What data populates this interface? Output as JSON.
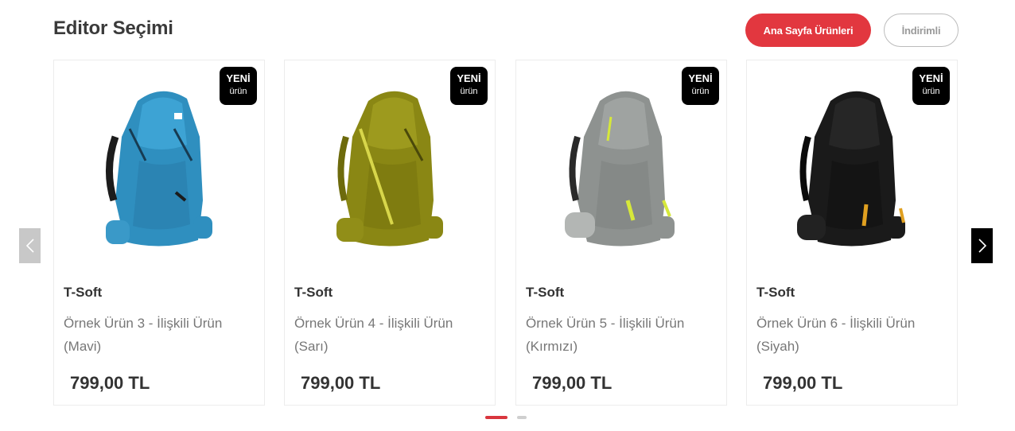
{
  "section": {
    "title": "Editor Seçimi"
  },
  "tabs": [
    {
      "label": "Ana Sayfa Ürünleri",
      "active": true
    },
    {
      "label": "İndirimli",
      "active": false
    }
  ],
  "colors": {
    "accent": "#e2373f",
    "badge": "#000000"
  },
  "products": [
    {
      "badge_line1": "YENİ",
      "badge_line2": "ürün",
      "brand": "T-Soft",
      "name": "Örnek Ürün 3 - İlişkili Ürün (Mavi)",
      "price": "799,00 TL",
      "image_icon": "backpack-blue-image"
    },
    {
      "badge_line1": "YENİ",
      "badge_line2": "ürün",
      "brand": "T-Soft",
      "name": "Örnek Ürün 4 - İlişkili Ürün (Sarı)",
      "price": "799,00 TL",
      "image_icon": "backpack-olive-image"
    },
    {
      "badge_line1": "YENİ",
      "badge_line2": "ürün",
      "brand": "T-Soft",
      "name": "Örnek Ürün 5 - İlişkili Ürün (Kırmızı)",
      "price": "799,00 TL",
      "image_icon": "backpack-grey-image"
    },
    {
      "badge_line1": "YENİ",
      "badge_line2": "ürün",
      "brand": "T-Soft",
      "name": "Örnek Ürün 6 - İlişkili Ürün (Siyah)",
      "price": "799,00 TL",
      "image_icon": "backpack-black-image"
    }
  ],
  "carousel": {
    "prev_icon": "chevron-left-icon",
    "next_icon": "chevron-right-icon",
    "pages": 2,
    "current_page": 1
  }
}
